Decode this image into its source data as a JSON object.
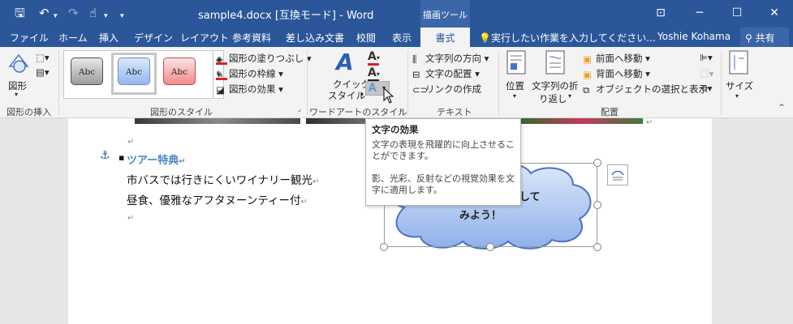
{
  "window": {
    "title": "sample4.docx [互換モード] - Word",
    "context_tab_group": "描画ツール",
    "buttons": {
      "ribbon_display": "⊡",
      "minimize": "─",
      "maximize": "☐",
      "close": "✕"
    }
  },
  "quick_access": {
    "save": "🖫",
    "undo": "↶",
    "redo": "↷",
    "touch": "☝",
    "more": "▾"
  },
  "tabs": [
    "ファイル",
    "ホーム",
    "挿入",
    "デザイン",
    "レイアウト",
    "参考資料",
    "差し込み文書",
    "校閲",
    "表示",
    "書式"
  ],
  "active_tab": "書式",
  "tell_me": "実行したい作業を入力してください...",
  "user": "Yoshie Kohama",
  "share": "共有",
  "ribbon": {
    "insert_shapes": {
      "label": "図形の挿入",
      "shape_button": "図形"
    },
    "shape_styles": {
      "label": "図形のスタイル",
      "gallery": [
        "Abc",
        "Abc",
        "Abc"
      ],
      "fill": "図形の塗りつぶし",
      "outline": "図形の枠線",
      "effects": "図形の効果"
    },
    "wordart": {
      "label": "ワードアートのスタイル",
      "quick_style_1": "クイック",
      "quick_style_2": "スタイル"
    },
    "text": {
      "label": "テキスト",
      "direction": "文字列の方向",
      "align": "文字の配置",
      "link": "リンクの作成"
    },
    "arrange": {
      "label": "配置",
      "position": "位置",
      "wrap_1": "文字列の折",
      "wrap_2": "り返し",
      "bring_forward": "前面へ移動",
      "send_backward": "背面へ移動",
      "selection_pane": "オブジェクトの選択と表示"
    },
    "size": {
      "label": "サイズ"
    }
  },
  "tooltip": {
    "title": "文字の効果",
    "line1": "文字の表現を飛躍的に向上させるこ",
    "line2": "とができます。",
    "line3": "影、光彩、反射などの視覚効果を文",
    "line4": "字に適用します。"
  },
  "document": {
    "heading": "ツアー特典",
    "line1": "市バスでは行きにくいワイナリー観光",
    "line2": "昼食、優雅なアフタヌーンティー付",
    "para_mark": "↵",
    "bullet": "▪",
    "anchor": "⚓",
    "cloud_line1": "して",
    "cloud_line2": "みよう！"
  },
  "colors": {
    "title_bar": "#2b579a",
    "ribbon_bg": "#f3f3f3",
    "heading_blue": "#4a86c6",
    "cloud_fill_top": "#d9e6fb",
    "cloud_fill_bottom": "#8fb0ea",
    "cloud_stroke": "#4a72c4"
  }
}
